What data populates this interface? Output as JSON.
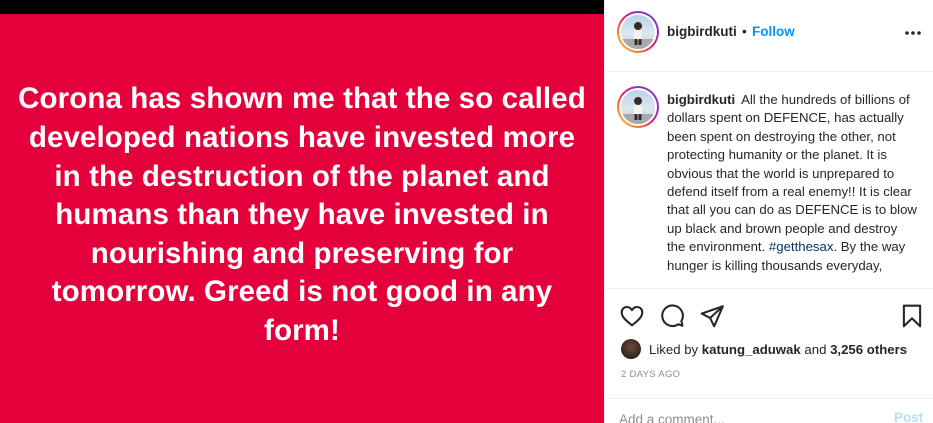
{
  "post": {
    "image_text": "Corona has shown me that the so called developed nations have invested more in the destruction of the planet and humans than they have invested in nourishing and preserving for tomorrow. Greed is not good in any form!",
    "image_background": "#e4003b"
  },
  "header": {
    "username": "bigbirdkuti",
    "separator": "•",
    "follow_label": "Follow",
    "more_icon": "more-horizontal-icon"
  },
  "caption": {
    "username": "bigbirdkuti",
    "text_before_tag": "All the hundreds of billions of dollars spent on DEFENCE, has actually been spent on destroying the other, not protecting humanity or the planet. It is obvious that the world is unprepared to defend itself from a real enemy!! It is clear that all you can do as DEFENCE is to blow up black and brown people and destroy the environment.",
    "hashtag": "#getthesax",
    "text_after_tag": ". By the way hunger is killing thousands everyday,"
  },
  "actions": {
    "like_icon": "heart-icon",
    "comment_icon": "comment-icon",
    "share_icon": "paper-plane-icon",
    "save_icon": "bookmark-icon"
  },
  "likes": {
    "prefix": "Liked by",
    "user": "katung_aduwak",
    "joiner": "and",
    "count": "3,256 others"
  },
  "timestamp": "2 DAYS AGO",
  "comment_box": {
    "placeholder": "Add a comment...",
    "post_label": "Post"
  },
  "colors": {
    "link_blue": "#0095f6",
    "hashtag": "#00376b",
    "muted": "#8e8e8e"
  }
}
